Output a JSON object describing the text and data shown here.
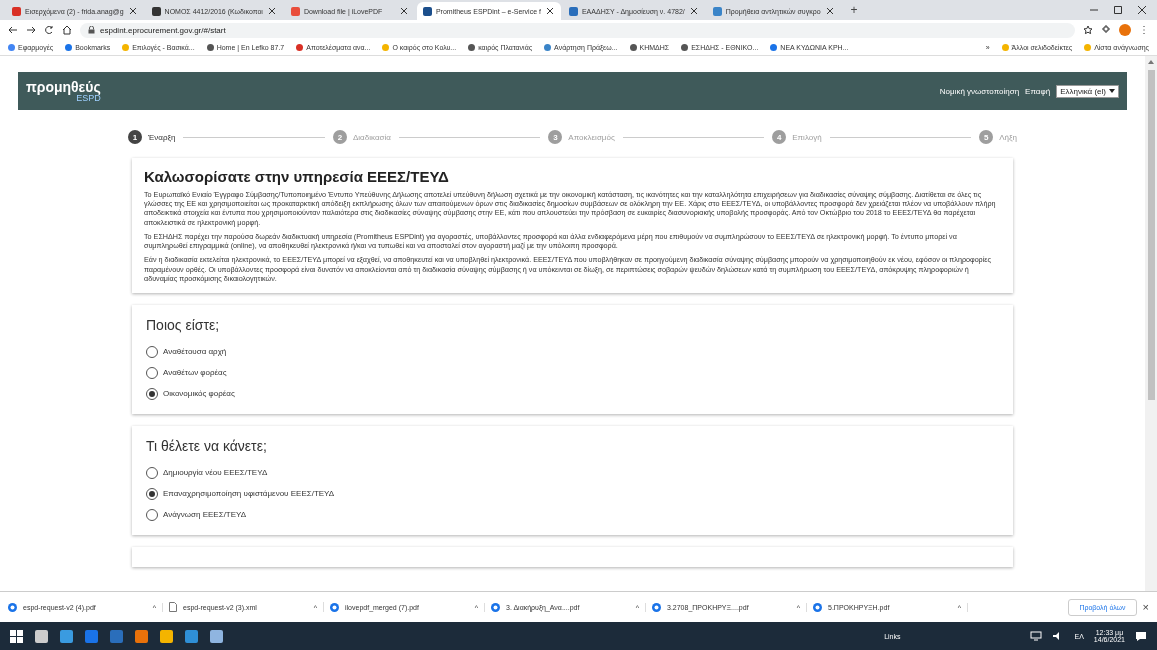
{
  "browser": {
    "tabs": [
      {
        "title": "Εισερχόμενα (2) - frida.anag@g",
        "selected": false
      },
      {
        "title": "ΝΟΜΟΣ 4412/2016 (Κωδικοποι",
        "selected": false
      },
      {
        "title": "Download file | iLovePDF",
        "selected": false
      },
      {
        "title": "Promitheus ESPDint – e-Service f",
        "selected": true
      },
      {
        "title": "ΕΑΑΔΗΣΥ - Δημοσίευση ν. 4782/",
        "selected": false
      },
      {
        "title": "Προμήθεια αντλητικών συγκρο",
        "selected": false
      }
    ],
    "new_tab": "+",
    "address": "espdint.eprocurement.gov.gr/#/start",
    "bookmarks": [
      "Εφαρμογές",
      "Bookmarks",
      "Επιλογές - Βασικά...",
      "Home | En Lefko 87.7",
      "Αποτελέσματα ανα...",
      "Ο καιρός στο Κολυ...",
      "καιρός Πλατανιάς",
      "Ανάρτηση Πράξεω...",
      "ΚΗΜΔΗΣ",
      "ΕΣΗΔΗΣ - ΕΘΝΙΚΟ...",
      "ΝΕΑ ΚΥΔΩΝΙΑ ΚΡΗ..."
    ],
    "more": "»",
    "other_bookmarks": [
      "Άλλοι σελιδοδείκτες",
      "Λίστα ανάγνωσης"
    ]
  },
  "header": {
    "logo": "προμηθεύς",
    "logo_sub": "ESPD",
    "links": [
      "Νομική γνωστοποίηση",
      "Επαφή"
    ],
    "language": "Ελληνικά (el)"
  },
  "steps": [
    {
      "number": "1",
      "label": "Έναρξη",
      "selected": true
    },
    {
      "number": "2",
      "label": "Διαδικασία",
      "selected": false
    },
    {
      "number": "3",
      "label": "Αποκλεισμός",
      "selected": false
    },
    {
      "number": "4",
      "label": "Επιλογή",
      "selected": false
    },
    {
      "number": "5",
      "label": "Λήξη",
      "selected": false
    }
  ],
  "intro": {
    "title": "Καλωσορίσατε στην υπηρεσία ΕΕΕΣ/ΤΕΥΔ",
    "paragraphs": [
      "Το Ευρωπαϊκό Ενιαίο Έγγραφο Σύμβασης/Τυποποιημένο Έντυπο Υπεύθυνης Δήλωσης αποτελεί υπεύθυνη δήλωση σχετικά με την οικονομική κατάσταση, τις ικανότητες και την καταλληλότητα επιχειρήσεων για διαδικασίες σύναψης σύμβασης. Διατίθεται σε όλες τις γλώσσες της ΕΕ και χρησιμοποιείται ως προκαταρκτική απόδειξη εκπλήρωσης όλων των απαιτούμενων όρων στις διαδικασίες δημοσίων συμβάσεων σε ολόκληρη την ΕΕ. Χάρις στο ΕΕΕΣ/ΤΕΥΔ, οι υποβάλλοντες προσφορά δεν χρειάζεται πλέον να υποβάλλουν πλήρη αποδεικτικά στοιχεία και έντυπα που χρησιμοποιούνταν παλαιότερα στις διαδικασίες σύναψης σύμβασης στην ΕΕ, κάτι που απλουστεύει την πρόσβαση σε ευκαιρίες διασυνοριακής υποβολής προσφοράς. Από τον Οκτώβριο του 2018 το ΕΕΕΣ/ΤΕΥΔ θα παρέχεται αποκλειστικά σε ηλεκτρονική μορφή.",
      "Το ΕΣΗΔΗΣ παρέχει την παρούσα δωρεάν διαδικτυακή υπηρεσία (Promitheus ESPDint) για αγοραστές, υποβάλλοντες προσφορά και άλλα ενδιαφερόμενα μέρη που επιθυμούν να συμπληρώσουν το ΕΕΕΣ/ΤΕΥΔ σε ηλεκτρονική μορφή. Το έντυπο μπορεί να συμπληρωθεί επιγραμμικά (online), να αποθηκευθεί ηλεκτρονικά ή/και να τυπωθεί και να αποσταλεί στον αγοραστή μαζί με την υπόλοιπη προσφορά.",
      "Εάν η διαδικασία εκτελείται ηλεκτρονικά, το ΕΕΕΣ/ΤΕΥΔ μπορεί να εξαχθεί, να αποθηκευτεί και να υποβληθεί ηλεκτρονικά. ΕΕΕΣ/ΤΕΥΔ που υποβλήθηκαν σε προηγούμενη διαδικασία σύναψης σύμβασης  μπορούν να χρησιμοποιηθούν εκ νέου, εφόσον οι πληροφορίες παραμένουν ορθές. Οι υποβάλλοντες προσφορά είναι δυνατόν να αποκλείονται από τη διαδικασία σύναψης σύμβασης ή να υπόκεινται σε δίωξη, σε περιπτώσεις σοβαρών ψευδών δηλώσεων κατά τη συμπλήρωση του ΕΕΕΣ/ΤΕΥΔ, απόκρυψης πληροφοριών ή αδυναμίας προσκόμισης δικαιολογητικών."
    ]
  },
  "questions": [
    {
      "title": "Ποιος είστε;",
      "options": [
        {
          "label": "Αναθέτουσα αρχή",
          "selected": false
        },
        {
          "label": "Αναθέτων φορέας",
          "selected": false
        },
        {
          "label": "Οικονομικός φορέας",
          "selected": true
        }
      ]
    },
    {
      "title": "Τι θέλετε να κάνετε;",
      "options": [
        {
          "label": "Δημιουργία νέου ΕΕΕΣ/ΤΕΥΔ",
          "selected": false
        },
        {
          "label": "Επαναχρησιμοποίηση υφιστάμενου ΕΕΕΣ/ΤΕΥΔ",
          "selected": true
        },
        {
          "label": "Ανάγνωση ΕΕΕΣ/ΤΕΥΔ",
          "selected": false
        }
      ]
    }
  ],
  "downloads": {
    "files": [
      {
        "name": "espd-request-v2 (4).pdf",
        "kind": "pdf"
      },
      {
        "name": "espd-request-v2 (3).xml",
        "kind": "xml"
      },
      {
        "name": "ilovepdf_merged (7).pdf",
        "kind": "pdf"
      },
      {
        "name": "3. Διακήρυξη_Ανα....pdf",
        "kind": "pdf"
      },
      {
        "name": "3.2708_ΠΡΟΚΗΡΥΞ....pdf",
        "kind": "pdf"
      },
      {
        "name": "5.ΠΡΟΚΗΡΥΞΗ.pdf",
        "kind": "pdf"
      }
    ],
    "caret": "^",
    "show_all": "Προβολή όλων",
    "close": "×"
  },
  "taskbar": {
    "links": "Links",
    "language": "ΕΛ",
    "time": "12:33 μμ",
    "date": "14/6/2021"
  }
}
